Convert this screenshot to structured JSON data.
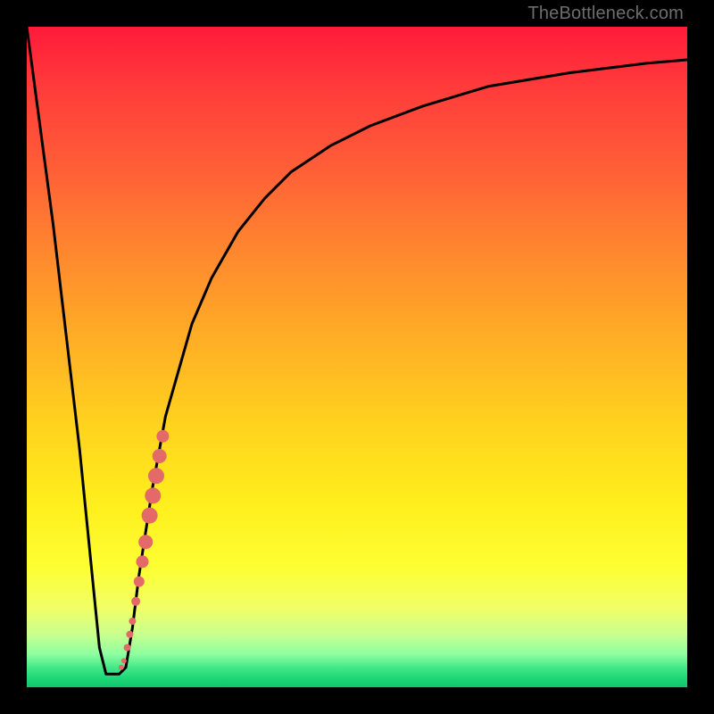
{
  "watermark": "TheBottleneck.com",
  "chart_data": {
    "type": "line",
    "title": "",
    "xlabel": "",
    "ylabel": "",
    "xlim": [
      0,
      100
    ],
    "ylim": [
      0,
      100
    ],
    "grid": false,
    "series": [
      {
        "name": "bottleneck-curve",
        "x": [
          0,
          4,
          8,
          10,
          11,
          12,
          13,
          14,
          15,
          16,
          17,
          19,
          21,
          23,
          25,
          28,
          32,
          36,
          40,
          46,
          52,
          60,
          70,
          82,
          94,
          100
        ],
        "y": [
          100,
          70,
          36,
          16,
          6,
          2,
          2,
          2,
          3,
          9,
          17,
          30,
          41,
          48,
          55,
          62,
          69,
          74,
          78,
          82,
          85,
          88,
          91,
          93,
          94.5,
          95
        ]
      }
    ],
    "markers": {
      "name": "highlight-dots",
      "color": "#e46a6a",
      "points": [
        {
          "x": 14.3,
          "y": 3,
          "r": 3
        },
        {
          "x": 14.7,
          "y": 4,
          "r": 3
        },
        {
          "x": 15.2,
          "y": 6,
          "r": 4
        },
        {
          "x": 15.6,
          "y": 8,
          "r": 4
        },
        {
          "x": 16.0,
          "y": 10,
          "r": 4
        },
        {
          "x": 16.5,
          "y": 13,
          "r": 5
        },
        {
          "x": 17.0,
          "y": 16,
          "r": 6
        },
        {
          "x": 17.5,
          "y": 19,
          "r": 7
        },
        {
          "x": 18.0,
          "y": 22,
          "r": 8
        },
        {
          "x": 18.6,
          "y": 26,
          "r": 9
        },
        {
          "x": 19.1,
          "y": 29,
          "r": 9
        },
        {
          "x": 19.6,
          "y": 32,
          "r": 9
        },
        {
          "x": 20.1,
          "y": 35,
          "r": 8
        },
        {
          "x": 20.6,
          "y": 38,
          "r": 7
        }
      ]
    }
  }
}
